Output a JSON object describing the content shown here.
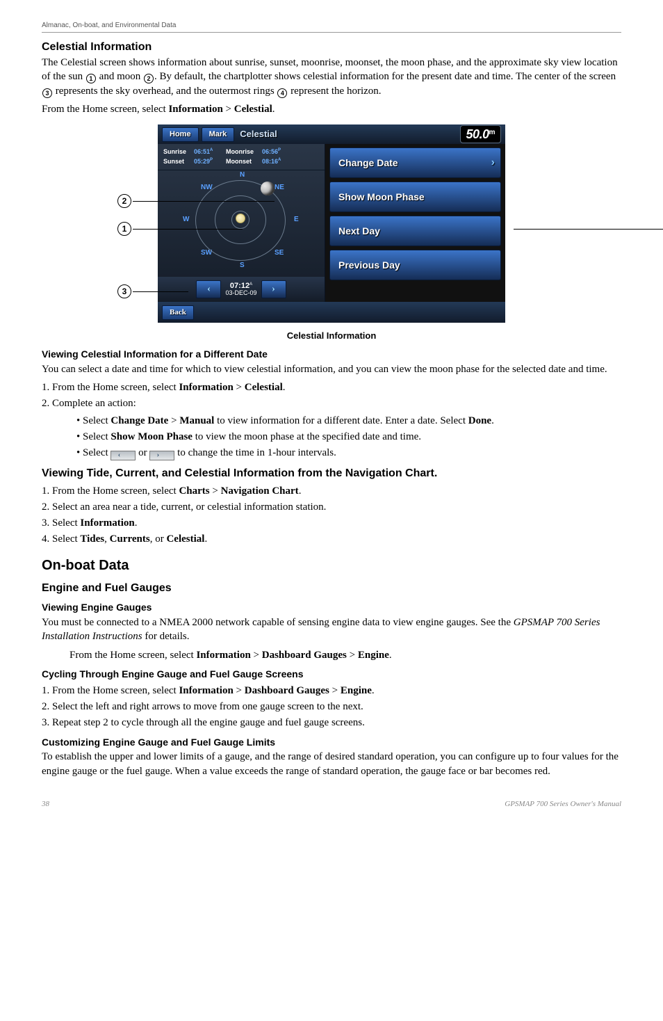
{
  "header": "Almanac, On-boat, and Environmental Data",
  "s1": {
    "title": "Celestial Information",
    "p1a": "The Celestial screen shows information about sunrise, sunset, moonrise, moonset, the moon phase, and the approximate sky view location of the sun",
    "p1b": "and moon",
    "p1c": ". By default, the chartplotter shows celestial information for the present date and time. The center of the screen",
    "p1d": "represents the sky overhead, and the outermost rings",
    "p1e": "represent the horizon.",
    "p2a": "From the Home screen, select ",
    "p2b": "Information",
    "p2c": "Celestial"
  },
  "fig": {
    "home": "Home",
    "mark": "Mark",
    "title": "Celestial",
    "depth": "50.0",
    "depth_unit": "m",
    "sunrise_l": "Sunrise",
    "sunrise_v": "06:51",
    "sunset_l": "Sunset",
    "sunset_v": "05:29",
    "moonrise_l": "Moonrise",
    "moonrise_v": "06:56",
    "moonset_l": "Moonset",
    "moonset_v": "08:16",
    "n": "N",
    "ne": "NE",
    "e": "E",
    "se": "SE",
    "s": "S",
    "sw": "SW",
    "w": "W",
    "nw": "NW",
    "time": "07:12",
    "date": "03-DEC-09",
    "menu1": "Change Date",
    "menu2": "Show Moon Phase",
    "menu3": "Next Day",
    "menu4": "Previous Day",
    "back": "Back",
    "caption": "Celestial Information",
    "c1": "➀",
    "c2": "➁",
    "c3": "➂",
    "c4": "➃"
  },
  "s2": {
    "title": "Viewing Celestial Information for a Different Date",
    "p": "You can select a date and time for which to view celestial information, and you can view the moon phase for the selected date and time.",
    "li1a": "1.  From the Home screen, select ",
    "li1b": "Information",
    "li1c": "Celestial",
    "li2": "2.  Complete an action:",
    "b1a": "Select ",
    "b1b": "Change Date",
    "b1c": "Manual",
    "b1d": " to view information for a different date. Enter a date. Select ",
    "b1e": "Done",
    "b2a": "Select ",
    "b2b": "Show Moon Phase",
    "b2c": " to view the moon phase at the specified date and time.",
    "b3a": "Select ",
    "b3b": " or ",
    "b3c": " to change the time in 1-hour intervals."
  },
  "s3": {
    "title": "Viewing Tide, Current, and Celestial Information from the Navigation Chart.",
    "li1a": "1.  From the Home screen, select ",
    "li1b": "Charts",
    "li1c": "Navigation Chart",
    "li2": "2.  Select an area near a tide, current, or celestial information station.",
    "li3a": "3.  Select ",
    "li3b": "Information",
    "li4a": "4.  Select ",
    "li4b": "Tides",
    "li4c": "Currents",
    "li4d": "Celestial"
  },
  "s4": {
    "title": "On-boat Data",
    "sub": "Engine and Fuel Gauges",
    "h": "Viewing Engine Gauges",
    "p1": "You must be connected to a NMEA 2000 network capable of sensing engine data to view engine gauges. See the ",
    "p1i": "GPSMAP 700 Series Installation Instructions",
    "p1e": " for details.",
    "ia": "From the Home screen, select ",
    "ib": "Information",
    "ic": "Dashboard Gauges",
    "id": "Engine"
  },
  "s5": {
    "title": "Cycling Through Engine Gauge and Fuel Gauge Screens",
    "li1a": "1.  From the Home screen, select ",
    "li1b": "Information",
    "li1c": "Dashboard Gauges",
    "li1d": "Engine",
    "li2": "2.  Select the left and right arrows to move from one gauge screen to the next.",
    "li3": "3.  Repeat step 2 to cycle through all the engine gauge and fuel gauge screens."
  },
  "s6": {
    "title": "Customizing Engine Gauge and Fuel Gauge Limits",
    "p": "To establish the upper and lower limits of a gauge, and the range of desired standard operation, you can configure up to four values for the engine gauge or the fuel gauge. When a value exceeds the range of standard operation, the gauge face or bar becomes red."
  },
  "footer": {
    "page": "38",
    "title": "GPSMAP 700 Series Owner's Manual"
  }
}
